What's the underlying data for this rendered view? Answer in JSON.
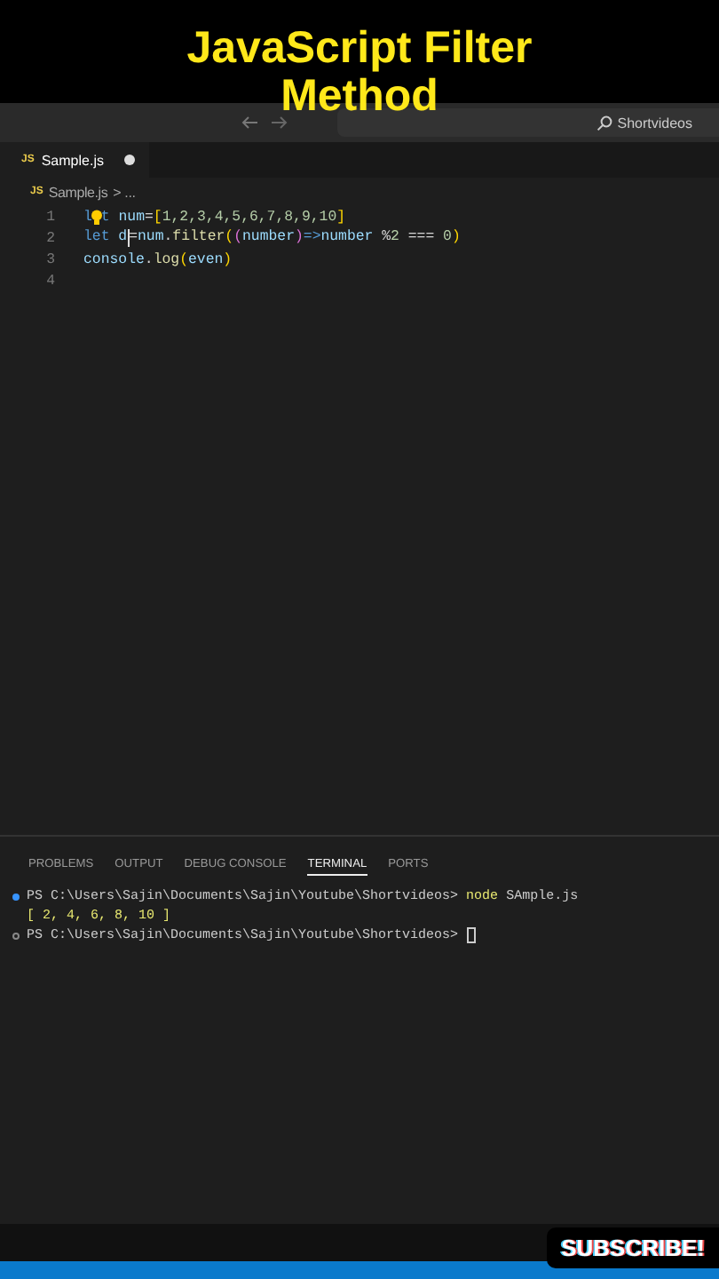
{
  "overlay_title": [
    "JavaScript Filter",
    "Method"
  ],
  "title_bar": {
    "search": "Shortvideos"
  },
  "tabs": [
    {
      "label": "Sample.js",
      "icon": "JS",
      "selected": true,
      "modified": true
    }
  ],
  "breadcrumb": {
    "icon": "JS",
    "file": "Sample.js",
    "rest": "> ..."
  },
  "code_lines": [
    {
      "number": "1",
      "tokens": [
        {
          "kind": "keyword",
          "text": "l"
        },
        {
          "kind": "bulb"
        },
        {
          "kind": "keyword",
          "text": "t"
        },
        {
          "kind": "variable",
          "text": " num"
        },
        {
          "kind": "plain",
          "text": "="
        },
        {
          "kind": "bracket",
          "text": "["
        },
        {
          "kind": "number",
          "text": "1,2,3,4,5,6,7,8,9,10"
        },
        {
          "kind": "bracket",
          "text": "]"
        }
      ]
    },
    {
      "number": "2",
      "tokens": [
        {
          "kind": "keyword",
          "text": "let"
        },
        {
          "kind": "variable",
          "text": " d"
        },
        {
          "kind": "cursor"
        },
        {
          "kind": "plain",
          "text": "="
        },
        {
          "kind": "variable",
          "text": "num"
        },
        {
          "kind": "plain",
          "text": "."
        },
        {
          "kind": "function",
          "text": "filter"
        },
        {
          "kind": "bracket",
          "text": "("
        },
        {
          "kind": "bracket2",
          "text": "("
        },
        {
          "kind": "variable",
          "text": "number"
        },
        {
          "kind": "bracket2",
          "text": ")"
        },
        {
          "kind": "keyword",
          "text": "=>"
        },
        {
          "kind": "variable",
          "text": "number"
        },
        {
          "kind": "plain",
          "text": " %"
        },
        {
          "kind": "number",
          "text": "2"
        },
        {
          "kind": "plain",
          "text": " === "
        },
        {
          "kind": "number",
          "text": "0"
        },
        {
          "kind": "bracket",
          "text": ")"
        }
      ]
    },
    {
      "number": "3",
      "tokens": [
        {
          "kind": "variable",
          "text": "console"
        },
        {
          "kind": "plain",
          "text": "."
        },
        {
          "kind": "function",
          "text": "log"
        },
        {
          "kind": "bracket",
          "text": "("
        },
        {
          "kind": "variable",
          "text": "even"
        },
        {
          "kind": "bracket",
          "text": ")"
        }
      ]
    },
    {
      "number": "4"
    }
  ],
  "panel_tabs": [
    {
      "label": "PROBLEMS",
      "selected": false
    },
    {
      "label": "OUTPUT",
      "selected": false
    },
    {
      "label": "DEBUG CONSOLE",
      "selected": false
    },
    {
      "label": "TERMINAL",
      "selected": true
    },
    {
      "label": "PORTS",
      "selected": false
    }
  ],
  "terminal_lines": [
    {
      "kind": "prompt-done",
      "prompt": "PS C:\\Users\\Sajin\\Documents\\Sajin\\Youtube\\Shortvideos>",
      "command": "node",
      "args": "SAmple.js"
    },
    {
      "kind": "output",
      "text": "[ 2, 4, 6, 8, 10 ]"
    },
    {
      "kind": "prompt-open",
      "prompt": "PS C:\\Users\\Sajin\\Documents\\Sajin\\Youtube\\Shortvideos>"
    }
  ],
  "subscribe_badge": "SUBSCRIBE!"
}
